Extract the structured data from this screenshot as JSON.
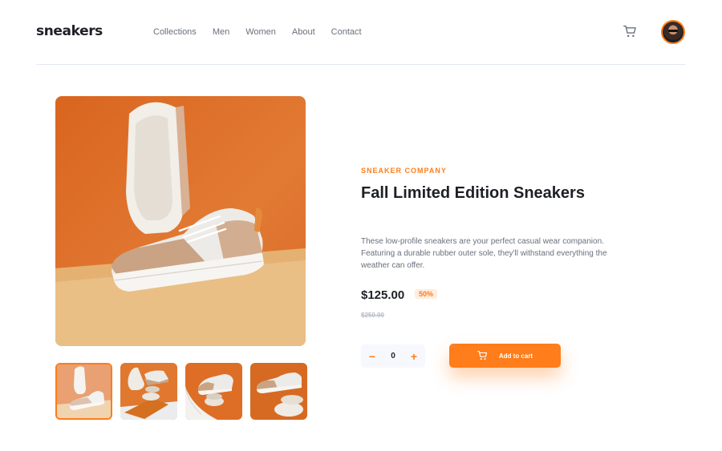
{
  "header": {
    "logo": "sneakers",
    "nav": [
      {
        "label": "Collections"
      },
      {
        "label": "Men"
      },
      {
        "label": "Women"
      },
      {
        "label": "About"
      },
      {
        "label": "Contact"
      }
    ],
    "cart_icon": "cart-icon",
    "avatar_icon": "avatar"
  },
  "product": {
    "company": "SNEAKER COMPANY",
    "title": "Fall Limited Edition Sneakers",
    "description": "These low-profile sneakers are your perfect casual wear companion. Featuring a durable rubber outer sole, they'll withstand everything the weather can offer.",
    "price": "$125.00",
    "discount": "50%",
    "old_price": "$250.00"
  },
  "quantity": {
    "minus": "−",
    "value": "0",
    "plus": "+"
  },
  "cart_button": {
    "label": "Add to cart"
  },
  "colors": {
    "accent": "#ff7d1a",
    "accent_light": "#ffede0",
    "text_dark": "#1d2026",
    "text_grey": "#69707d"
  }
}
